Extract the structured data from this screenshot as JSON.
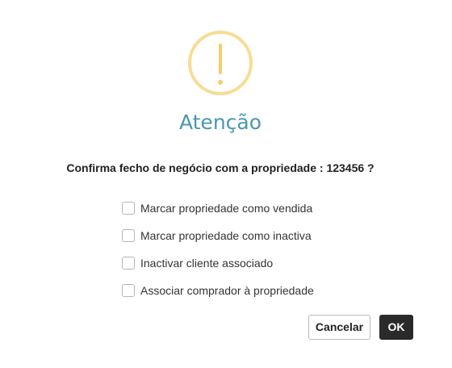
{
  "dialog": {
    "icon": "warning-exclamation-icon",
    "title": "Atenção",
    "message": "Confirma fecho de negócio com a propriedade : 123456 ?",
    "options": [
      {
        "label": "Marcar propriedade como vendida",
        "checked": false
      },
      {
        "label": "Marcar propriedade como inactiva",
        "checked": false
      },
      {
        "label": "Inactivar cliente associado",
        "checked": false
      },
      {
        "label": "Associar comprador à propriedade",
        "checked": false
      }
    ],
    "buttons": {
      "cancel_label": "Cancelar",
      "ok_label": "OK"
    }
  },
  "colors": {
    "icon_ring": "#f8dc94",
    "icon_mark": "#f4cd6e",
    "title": "#4a97b0",
    "ok_button": "#2a2a2a"
  }
}
